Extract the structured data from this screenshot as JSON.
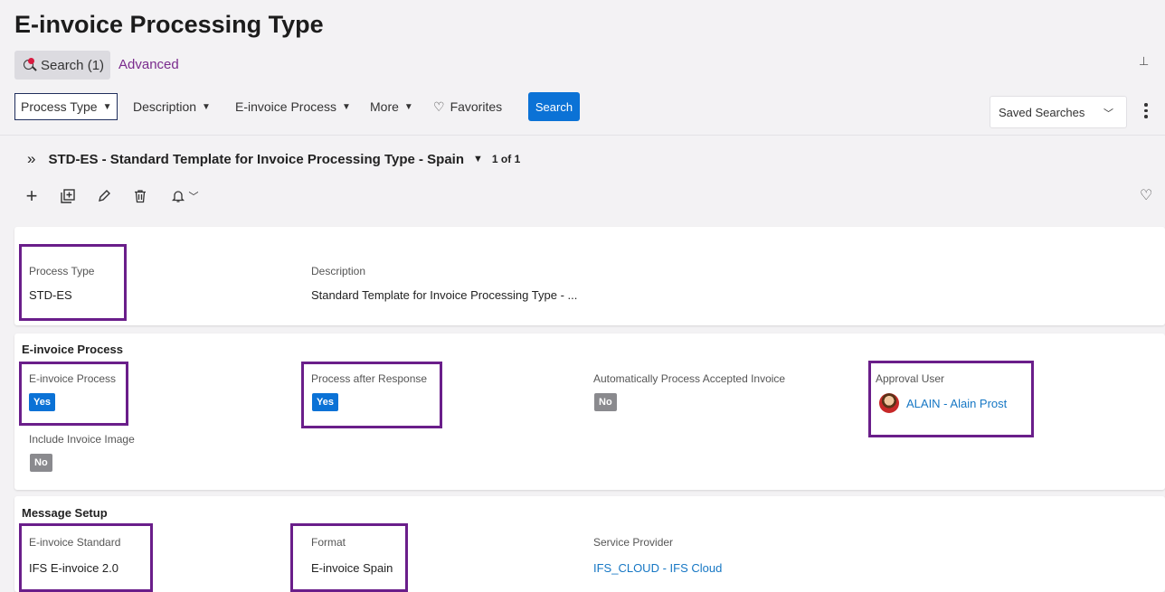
{
  "page": {
    "title": "E-invoice Processing Type"
  },
  "search_tabs": {
    "search_label": "Search (1)",
    "advanced_label": "Advanced"
  },
  "filters": {
    "items": [
      "Process Type",
      "Description",
      "E-invoice Process",
      "More"
    ],
    "favorites_label": "Favorites",
    "search_button": "Search",
    "saved_searches": "Saved Searches"
  },
  "record": {
    "title": "STD-ES - Standard Template for Invoice Processing Type - Spain",
    "count": "1 of 1"
  },
  "header_card": {
    "process_type_label": "Process Type",
    "process_type_value": "STD-ES",
    "description_label": "Description",
    "description_value": "Standard Template for Invoice Processing Type - ..."
  },
  "einvoice_section": {
    "title": "E-invoice Process",
    "einvoice_process_label": "E-invoice Process",
    "einvoice_process_value": "Yes",
    "process_after_response_label": "Process after Response",
    "process_after_response_value": "Yes",
    "auto_process_label": "Automatically Process Accepted Invoice",
    "auto_process_value": "No",
    "approval_user_label": "Approval User",
    "approval_user_value": "ALAIN - Alain Prost",
    "include_image_label": "Include Invoice Image",
    "include_image_value": "No"
  },
  "message_section": {
    "title": "Message Setup",
    "standard_label": "E-invoice Standard",
    "standard_value": "IFS E-invoice 2.0",
    "format_label": "Format",
    "format_value": "E-invoice Spain",
    "provider_label": "Service Provider",
    "provider_value": "IFS_CLOUD - IFS Cloud"
  },
  "colors": {
    "accent": "#0b72d6",
    "highlight": "#6a1e8a",
    "link": "#1677c4",
    "no_badge": "#8a8a8e"
  }
}
